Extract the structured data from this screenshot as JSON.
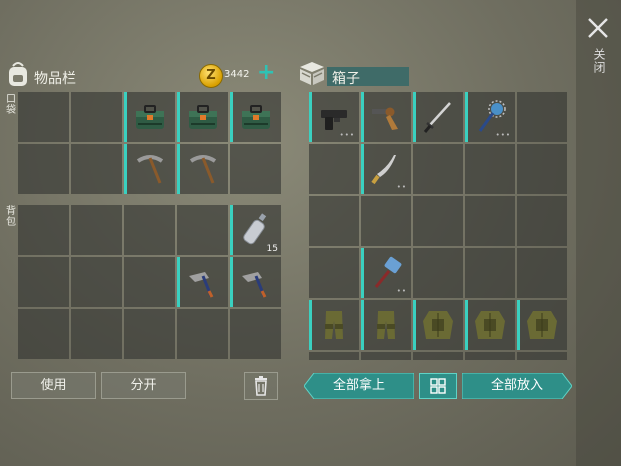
{
  "close": {
    "label": "关闭"
  },
  "inventory": {
    "title": "物品栏",
    "pocket_label": "口袋",
    "backpack_label": "背包",
    "coins": "3442",
    "pocket": [
      {
        "icon": ""
      },
      {
        "icon": ""
      },
      {
        "icon": "green-case-icon"
      },
      {
        "icon": "green-case-icon"
      },
      {
        "icon": "green-case-icon"
      },
      {
        "icon": ""
      },
      {
        "icon": ""
      },
      {
        "icon": "pickaxe-icon"
      },
      {
        "icon": "pickaxe-icon"
      },
      {
        "icon": ""
      }
    ],
    "backpack": [
      {
        "icon": ""
      },
      {
        "icon": ""
      },
      {
        "icon": ""
      },
      {
        "icon": ""
      },
      {
        "icon": "water-bottle-icon",
        "qty": "15"
      },
      {
        "icon": ""
      },
      {
        "icon": ""
      },
      {
        "icon": ""
      },
      {
        "icon": "hammer-axe-icon"
      },
      {
        "icon": "hammer-axe-icon"
      },
      {
        "icon": ""
      },
      {
        "icon": ""
      },
      {
        "icon": ""
      },
      {
        "icon": ""
      },
      {
        "icon": ""
      }
    ],
    "use_label": "使用",
    "split_label": "分开"
  },
  "box": {
    "title": "箱子",
    "items": [
      {
        "icon": "pistol-icon",
        "dots": "•••"
      },
      {
        "icon": "revolver-icon",
        "dots": ""
      },
      {
        "icon": "katana-icon",
        "dots": ""
      },
      {
        "icon": "spiked-mace-icon",
        "dots": "•••"
      },
      {
        "icon": ""
      },
      {
        "icon": ""
      },
      {
        "icon": "machete-icon",
        "dots": "••"
      },
      {
        "icon": ""
      },
      {
        "icon": ""
      },
      {
        "icon": ""
      },
      {
        "icon": ""
      },
      {
        "icon": ""
      },
      {
        "icon": ""
      },
      {
        "icon": ""
      },
      {
        "icon": ""
      },
      {
        "icon": ""
      },
      {
        "icon": "sledgehammer-icon",
        "dots": "••"
      },
      {
        "icon": ""
      },
      {
        "icon": ""
      },
      {
        "icon": ""
      },
      {
        "icon": "armor-pants-icon",
        "dots": ""
      },
      {
        "icon": "armor-pants-icon",
        "dots": ""
      },
      {
        "icon": "armor-vest-icon",
        "dots": ""
      },
      {
        "icon": "armor-vest-icon",
        "dots": ""
      },
      {
        "icon": "armor-vest-icon",
        "dots": ""
      }
    ],
    "take_all_label": "全部拿上",
    "put_all_label": "全部放入"
  }
}
